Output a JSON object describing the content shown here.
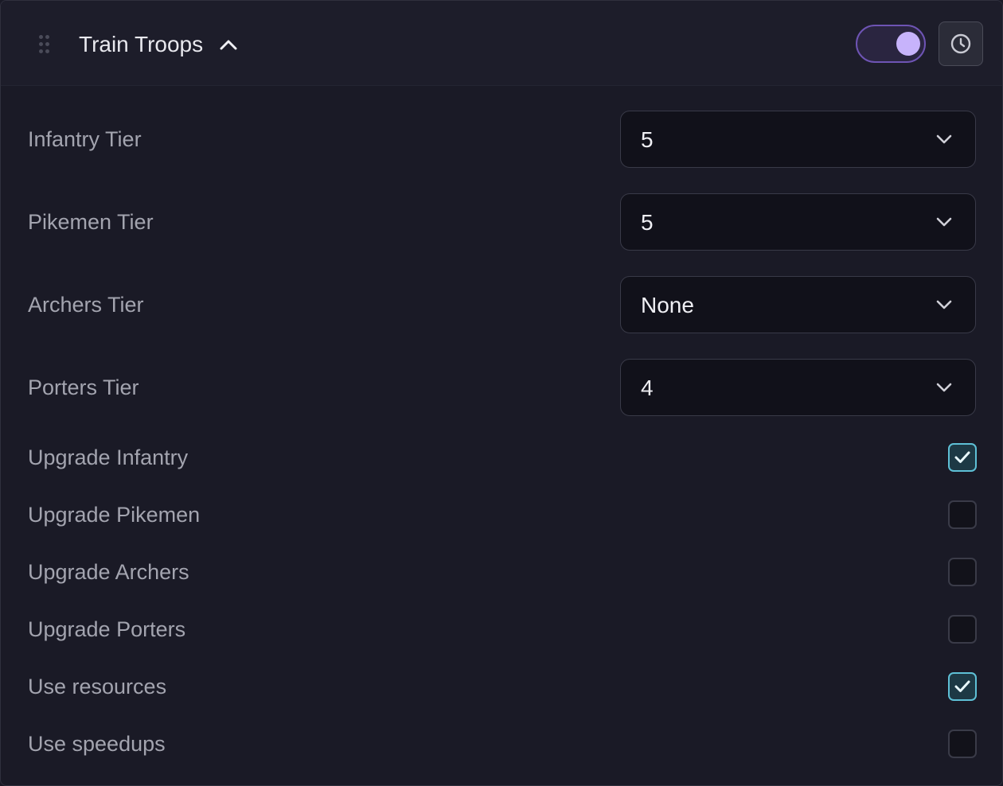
{
  "header": {
    "title": "Train Troops",
    "enabled": true,
    "icons": {
      "drag": "drag-handle-icon",
      "collapse": "chevron-up-icon",
      "history": "clock-icon"
    }
  },
  "selects": [
    {
      "label": "Infantry Tier",
      "value": "5"
    },
    {
      "label": "Pikemen Tier",
      "value": "5"
    },
    {
      "label": "Archers Tier",
      "value": "None"
    },
    {
      "label": "Porters Tier",
      "value": "4"
    }
  ],
  "checkboxes": [
    {
      "label": "Upgrade Infantry",
      "checked": true
    },
    {
      "label": "Upgrade Pikemen",
      "checked": false
    },
    {
      "label": "Upgrade Archers",
      "checked": false
    },
    {
      "label": "Upgrade Porters",
      "checked": false
    },
    {
      "label": "Use resources",
      "checked": true
    },
    {
      "label": "Use speedups",
      "checked": false
    }
  ],
  "colors": {
    "background": "#1a1a26",
    "accent": "#c7b3fb",
    "check": "#5ec0d6"
  }
}
